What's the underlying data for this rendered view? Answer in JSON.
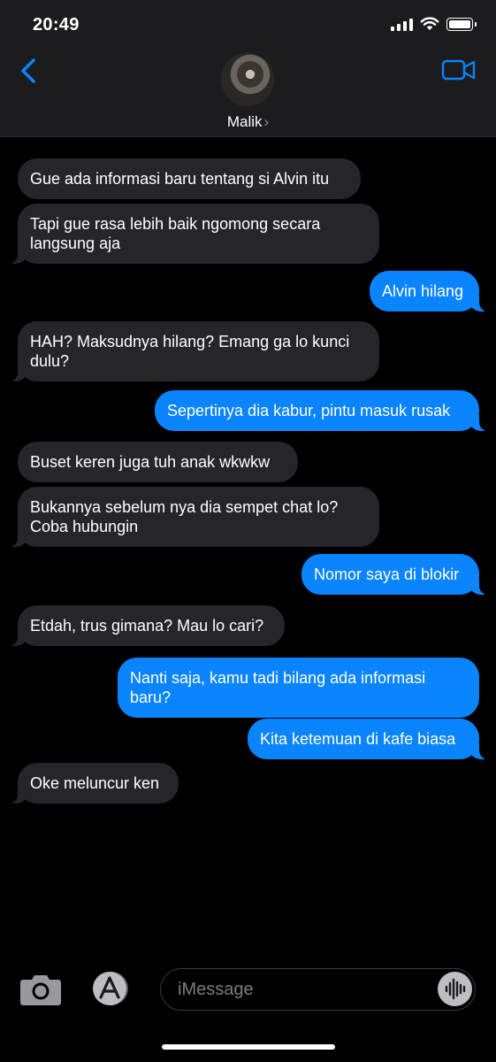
{
  "status_bar": {
    "time": "20:49"
  },
  "header": {
    "contact_name": "Malik",
    "chevron": "›",
    "icons": {
      "back": "chevron-left-icon",
      "video": "video-camera-icon"
    },
    "accent_color": "#0a84ff"
  },
  "messages": [
    {
      "direction": "incoming",
      "text": "Gue ada informasi baru tentang si Alvin itu"
    },
    {
      "direction": "incoming",
      "text": "Tapi gue rasa lebih baik ngomong secara langsung aja"
    },
    {
      "direction": "outgoing",
      "text": "Alvin hilang"
    },
    {
      "direction": "incoming",
      "text": "HAH? Maksudnya hilang? Emang ga lo kunci dulu?"
    },
    {
      "direction": "outgoing",
      "text": "Sepertinya dia kabur, pintu masuk rusak"
    },
    {
      "direction": "incoming",
      "text": "Buset keren juga tuh anak wkwkw"
    },
    {
      "direction": "incoming",
      "text": "Bukannya sebelum nya dia sempet chat lo? Coba hubungin"
    },
    {
      "direction": "outgoing",
      "text": "Nomor saya di blokir"
    },
    {
      "direction": "incoming",
      "text": "Etdah, trus gimana? Mau lo cari?"
    },
    {
      "direction": "outgoing",
      "text": "Nanti saja, kamu tadi bilang ada informasi baru?"
    },
    {
      "direction": "outgoing",
      "text": "Kita ketemuan di kafe biasa"
    },
    {
      "direction": "incoming",
      "text": "Oke meluncur ken"
    }
  ],
  "input_bar": {
    "placeholder": "iMessage",
    "icons": {
      "camera": "camera-icon",
      "apps": "app-store-icon",
      "audio": "audio-waveform-icon"
    }
  },
  "colors": {
    "incoming_bubble": "#26252a",
    "outgoing_bubble": "#0a84ff",
    "background": "#000000"
  }
}
